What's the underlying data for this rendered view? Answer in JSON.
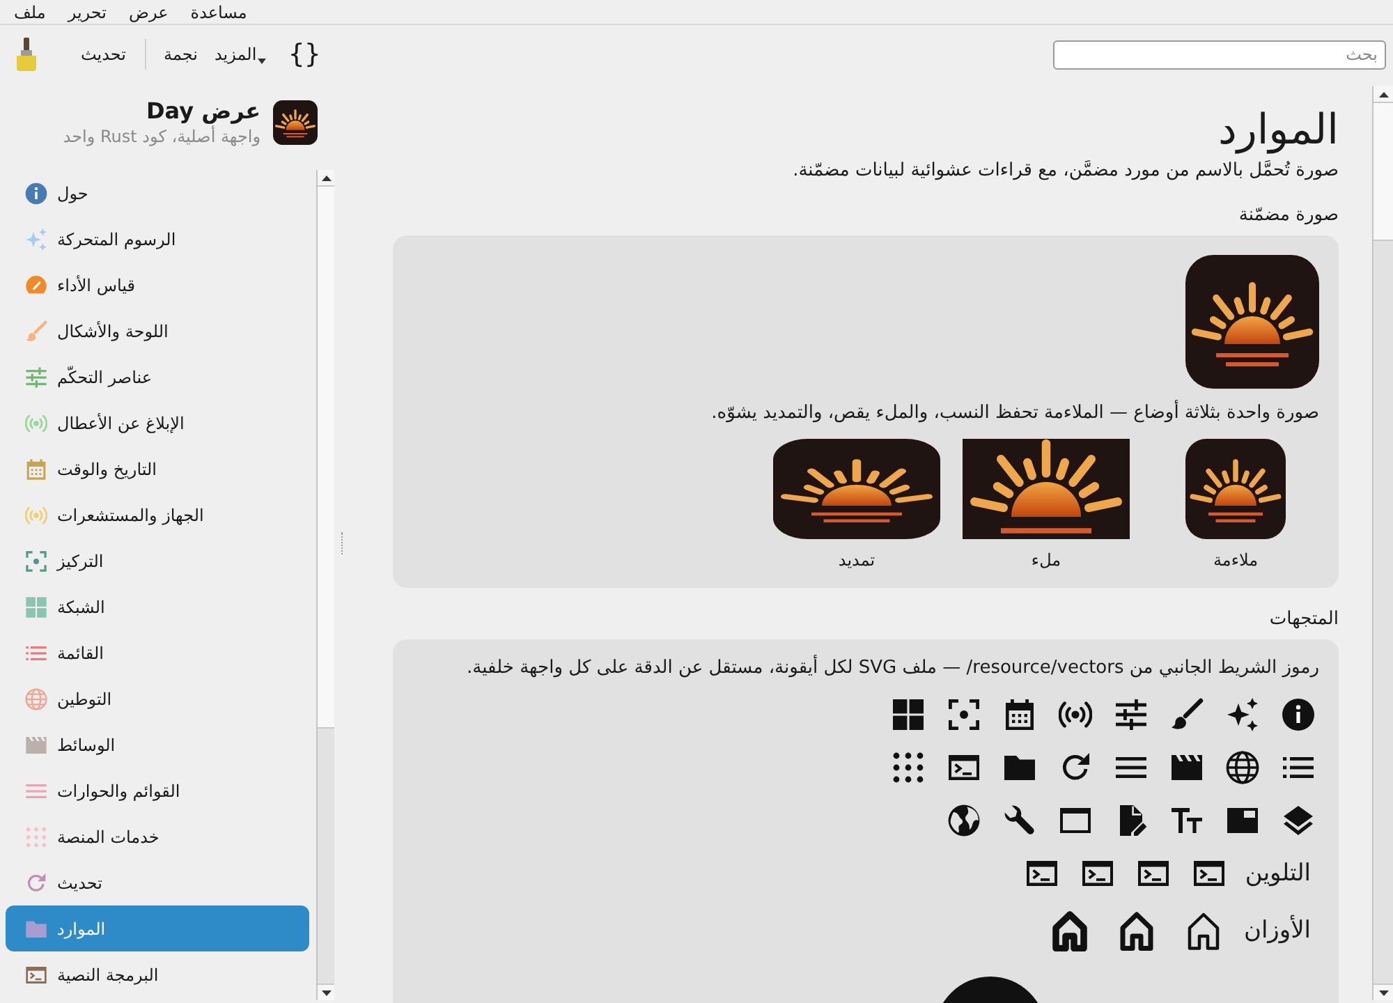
{
  "menu_bar": [
    {
      "label": "مساعدة"
    },
    {
      "label": "عرض"
    },
    {
      "label": "تحرير"
    },
    {
      "label": "ملف"
    }
  ],
  "toolbar": {
    "items": [
      {
        "kind": "code",
        "label": "{}"
      },
      {
        "kind": "menu",
        "label": "المزيد"
      },
      {
        "kind": "button",
        "label": "نجمة"
      },
      {
        "kind": "separator"
      },
      {
        "kind": "button",
        "label": "تحديث"
      }
    ]
  },
  "search": {
    "placeholder": "بحث"
  },
  "sidebar": {
    "title": "عرض Day",
    "subtitle": "واجهة أصلية، كود Rust واحد",
    "items": [
      {
        "label": "حول",
        "color": "#4a7ab4",
        "selected": false
      },
      {
        "label": "الرسوم المتحركة",
        "color": "#a8caf0",
        "selected": false
      },
      {
        "label": "قياس الأداء",
        "color": "#f08a24",
        "selected": false
      },
      {
        "label": "اللوحة والأشكال",
        "color": "#f6b47c",
        "selected": false
      },
      {
        "label": "عناصر التحكّم",
        "color": "#70b870",
        "selected": false
      },
      {
        "label": "الإبلاغ عن الأعطال",
        "color": "#96da96",
        "selected": false
      },
      {
        "label": "التاريخ والوقت",
        "color": "#c8a44c",
        "selected": false
      },
      {
        "label": "الجهاز والمستشعرات",
        "color": "#f0d070",
        "selected": false
      },
      {
        "label": "التركيز",
        "color": "#4a9c8c",
        "selected": false
      },
      {
        "label": "الشبكة",
        "color": "#8cc4b4",
        "selected": false
      },
      {
        "label": "القائمة",
        "color": "#e87c7c",
        "selected": false
      },
      {
        "label": "التوطين",
        "color": "#f4a494",
        "selected": false
      },
      {
        "label": "الوسائط",
        "color": "#bcb0ac",
        "selected": false
      },
      {
        "label": "القوائم والحوارات",
        "color": "#e8a4b4",
        "selected": false
      },
      {
        "label": "خدمات المنصة",
        "color": "#f4c4cc",
        "selected": false
      },
      {
        "label": "تحديث",
        "color": "#c48cb4",
        "selected": false
      },
      {
        "label": "الموارد",
        "color": "#a89cd0",
        "selected": true
      },
      {
        "label": "البرمجة النصية",
        "color": "#8c6c54",
        "selected": false
      }
    ]
  },
  "page": {
    "title": "الموارد",
    "subtitle": "صورة تُحمَّل بالاسم من مورد مضمَّن، مع قراءات عشوائية لبيانات مضمّنة.",
    "sections": [
      {
        "kind": "image",
        "heading": "صورة مضمّنة",
        "caption": "صورة واحدة بثلاثة أوضاع — الملاءمة تحفظ النسب، والملء يقص، والتمديد يشوّه.",
        "modes": [
          {
            "kind": "fit",
            "label": "ملاءمة"
          },
          {
            "kind": "fill",
            "label": "ملء"
          },
          {
            "kind": "stretch",
            "label": "تمديد"
          }
        ]
      },
      {
        "kind": "vectors",
        "heading": "المتجهات",
        "caption": "رموز الشريط الجانبي من resource/vectors/ — ملف SVG لكل أيقونة، مستقل عن الدقة على كل واجهة خلفية.",
        "rows": [
          {
            "kind": "tints",
            "label": "التلوين"
          },
          {
            "kind": "weights",
            "label": "الأوزان"
          }
        ]
      }
    ]
  }
}
